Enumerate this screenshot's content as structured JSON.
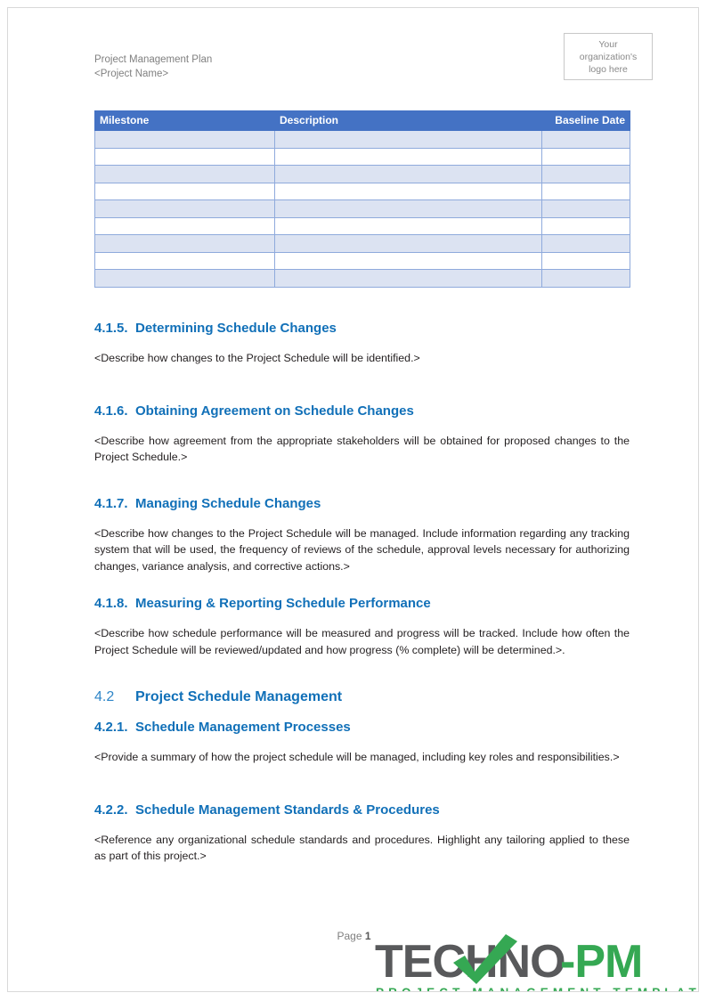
{
  "document": {
    "header": {
      "title_line1": "Project Management Plan",
      "title_line2": "<Project Name>",
      "title_block": "Project Management Plan\n<Project Name>",
      "logo_placeholder": "Your\norganization's\nlogo here",
      "logo_placeholder_line1": "Your",
      "logo_placeholder_line2": "organization's",
      "logo_placeholder_line3": "logo here"
    },
    "milestone_table": {
      "columns": [
        "Milestone",
        "Description",
        "Baseline Date"
      ],
      "row_count": 9,
      "rows": [
        [
          "",
          "",
          ""
        ],
        [
          "",
          "",
          ""
        ],
        [
          "",
          "",
          ""
        ],
        [
          "",
          "",
          ""
        ],
        [
          "",
          "",
          ""
        ],
        [
          "",
          "",
          ""
        ],
        [
          "",
          "",
          ""
        ],
        [
          "",
          "",
          ""
        ],
        [
          "",
          "",
          ""
        ]
      ]
    },
    "sections": [
      {
        "number": "4.1.5.",
        "title": "Determining Schedule Changes",
        "level": "minor",
        "body": "<Describe how changes to the Project Schedule will be identified.>"
      },
      {
        "number": "4.1.6.",
        "title": "Obtaining Agreement on Schedule Changes",
        "level": "minor",
        "body": "<Describe how agreement from the appropriate stakeholders will be obtained for proposed changes to the Project Schedule.>"
      },
      {
        "number": "4.1.7.",
        "title": "Managing Schedule Changes",
        "level": "minor",
        "body": "<Describe how changes to the Project Schedule will be managed. Include information regarding any tracking system that will be used, the frequency of reviews of the schedule, approval levels necessary for authorizing changes, variance analysis, and corrective actions.>"
      },
      {
        "number": "4.1.8.",
        "title": "Measuring & Reporting Schedule Performance",
        "level": "minor",
        "body": "<Describe how schedule performance will be measured and progress will be tracked. Include how often the Project Schedule will be reviewed/updated and how progress (% complete) will be determined.>."
      },
      {
        "number": "4.2",
        "title": "Project Schedule Management",
        "level": "major",
        "body": ""
      },
      {
        "number": "4.2.1.",
        "title": "Schedule Management Processes",
        "level": "minor",
        "body": "<Provide a summary of how the project schedule will be managed, including key roles and responsibilities.>"
      },
      {
        "number": "4.2.2.",
        "title": "Schedule Management Standards & Procedures",
        "level": "minor",
        "body": "<Reference any organizational schedule standards and procedures. Highlight any tailoring applied to these as part of this project.>"
      }
    ],
    "footer": {
      "page_label": "Page",
      "page_number": "1"
    },
    "brand": {
      "name_dark": "TECH",
      "name_dark2": "NO",
      "name_green": "-PM",
      "wordmark": "TECHNO-PM",
      "tagline": "PROJECT MANAGEMENT TEMPLATES"
    },
    "colors": {
      "heading_blue": "#1170b8",
      "table_header_blue": "#4472c4",
      "table_row_shade": "#dce3f2",
      "table_border": "#8faadc",
      "brand_green": "#35a853",
      "brand_gray": "#58595b",
      "body_text": "#231f20",
      "header_gray": "#808080"
    }
  }
}
